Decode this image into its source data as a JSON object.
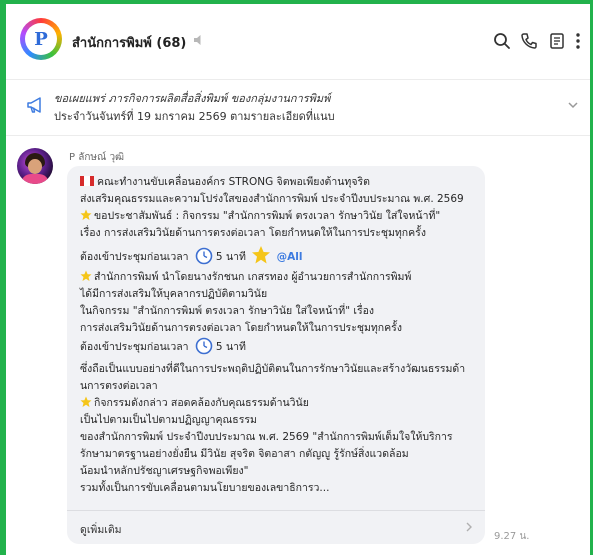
{
  "header": {
    "avatar_text": "P",
    "title": "สำนักการพิมพ์ (68)"
  },
  "announcement": {
    "line1": "ขอเผยแพร่ ภารกิจการผลิตสื่อสิ่งพิมพ์ ของกลุ่มงานการพิมพ์",
    "line2": "ประจำวันจันทร์ที่ 19 มกราคม 2569 ตามรายละเอียดที่แนบ"
  },
  "message": {
    "sender": "P ลักษณ์ วุฒิ",
    "lines": [
      "คณะทำงานขับเคลื่อนองค์กร STRONG จิตพอเพียงต้านทุจริต",
      "ส่งเสริมคุณธรรมและความโปร่งใสของสำนักการพิมพ์ ประจำปีงบประมาณ พ.ศ. 2569",
      "ขอประชาสัมพันธ์ : กิจกรรม \"สำนักการพิมพ์ ตรงเวลา รักษาวินัย ใส่ใจหน้าที่\"",
      "เรื่อง การส่งเสริมวินัยด้านการตรงต่อเวลา โดยกำหนดให้ในการประชุมทุกครั้ง",
      "ต้องเข้าประชุมก่อนเวลา",
      "5 นาที",
      "@All",
      "สำนักการพิมพ์ นำโดยนางรักชนก เกสรทอง ผู้อำนวยการสำนักการพิมพ์",
      "ได้มีการส่งเสริมให้บุคลากรปฏิบัติตามวินัย",
      "ในกิจกรรม \"สำนักการพิมพ์ ตรงเวลา รักษาวินัย ใส่ใจหน้าที่\" เรื่อง",
      "การส่งเสริมวินัยด้านการตรงต่อเวลา โดยกำหนดให้ในการประชุมทุกครั้ง",
      "ต้องเข้าประชุมก่อนเวลา",
      "5 นาที",
      "ซึ่งถือเป็นแบบอย่างที่ดีในการประพฤติปฏิบัติตนในการรักษาวินัยและสร้างวัฒนธรรมด้า",
      "นการตรงต่อเวลา",
      "กิจกรรมดังกล่าว สอดคล้องกับคุณธรรมด้านวินัย",
      "เป็นไปตามเป็นไปตามปฏิญญาคุณธรรม",
      "ของสำนักการพิมพ์ ประจำปีงบประมาณ พ.ศ. 2569 \"สำนักการพิมพ์เต็มใจให้บริการ",
      "รักษามาตรฐานอย่างยั่งยืน มีวินัย สุจริต จิตอาสา กตัญญู รู้รักษ์สิ่งแวดล้อม",
      "น้อมนำหลักปรัชญาเศรษฐกิจพอเพียง\"",
      "รวมทั้งเป็นการขับเคลื่อนตามนโยบายของเลขาธิการว..."
    ],
    "see_more": "ดูเพิ่มเติม",
    "time": "9.27 น."
  },
  "colors": {
    "frame": "#22b24c",
    "mention": "#3d7be0",
    "bubble": "#f1f2f5"
  },
  "icons": [
    "mute-icon",
    "search-icon",
    "phone-icon",
    "notes-icon",
    "more-icon",
    "megaphone-icon",
    "chevron-down-icon",
    "star-icon",
    "clock-icon",
    "flag-icon",
    "chevron-right-icon"
  ]
}
